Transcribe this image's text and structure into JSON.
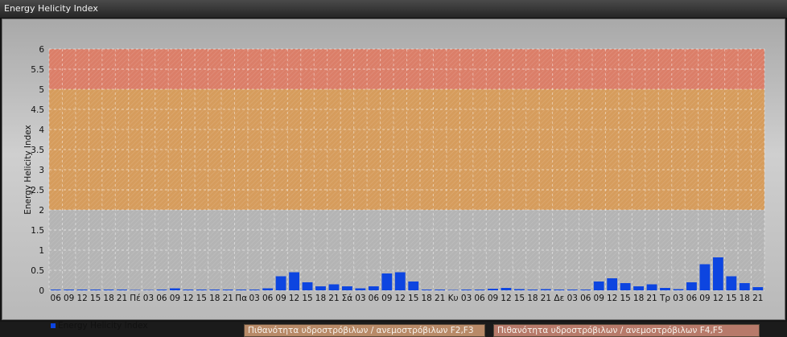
{
  "window": {
    "title": "Energy Helicity Index"
  },
  "chart_data": {
    "type": "bar",
    "title": "",
    "ylabel": "Energy Helicity Index",
    "xlabel": "",
    "ylim": [
      0,
      6
    ],
    "yticks": [
      "0",
      "0.5",
      "1",
      "1.5",
      "2",
      "2.5",
      "3",
      "3.5",
      "4",
      "4.5",
      "5",
      "5.5",
      "6"
    ],
    "grid": true,
    "legend_position": "bottom-left",
    "categories": [
      "06",
      "09",
      "12",
      "15",
      "18",
      "21",
      "Πέ",
      "03",
      "06",
      "09",
      "12",
      "15",
      "18",
      "21",
      "Πα",
      "03",
      "06",
      "09",
      "12",
      "15",
      "18",
      "21",
      "Σά",
      "03",
      "06",
      "09",
      "12",
      "15",
      "18",
      "21",
      "Κυ",
      "03",
      "06",
      "09",
      "12",
      "15",
      "18",
      "21",
      "Δε",
      "03",
      "06",
      "09",
      "12",
      "15",
      "18",
      "21",
      "Τρ",
      "03",
      "06",
      "09",
      "12",
      "15",
      "18",
      "21"
    ],
    "series": [
      {
        "name": "Energy Helicity Index",
        "color": "#0d45e0",
        "values": [
          0.02,
          0.02,
          0.02,
          0.02,
          0.02,
          0.02,
          0.01,
          0.01,
          0.02,
          0.05,
          0.02,
          0.02,
          0.02,
          0.02,
          0.02,
          0.02,
          0.05,
          0.35,
          0.45,
          0.2,
          0.1,
          0.15,
          0.1,
          0.05,
          0.1,
          0.42,
          0.45,
          0.22,
          0.02,
          0.02,
          0.01,
          0.02,
          0.02,
          0.04,
          0.06,
          0.03,
          0.02,
          0.03,
          0.02,
          0.02,
          0.02,
          0.22,
          0.3,
          0.18,
          0.1,
          0.15,
          0.06,
          0.03,
          0.2,
          0.65,
          0.82,
          0.35,
          0.18,
          0.08
        ]
      }
    ],
    "zones": [
      {
        "from": 2,
        "to": 5,
        "color": "#d99a55",
        "label": "Πιθανότητα υδροστρόβιλων / ανεμοστρόβιλων F2,F3"
      },
      {
        "from": 5,
        "to": 6,
        "color": "#de7a62",
        "label": "Πιθανότητα υδροστρόβιλων / ανεμοστρόβιλων F4,F5"
      }
    ]
  }
}
